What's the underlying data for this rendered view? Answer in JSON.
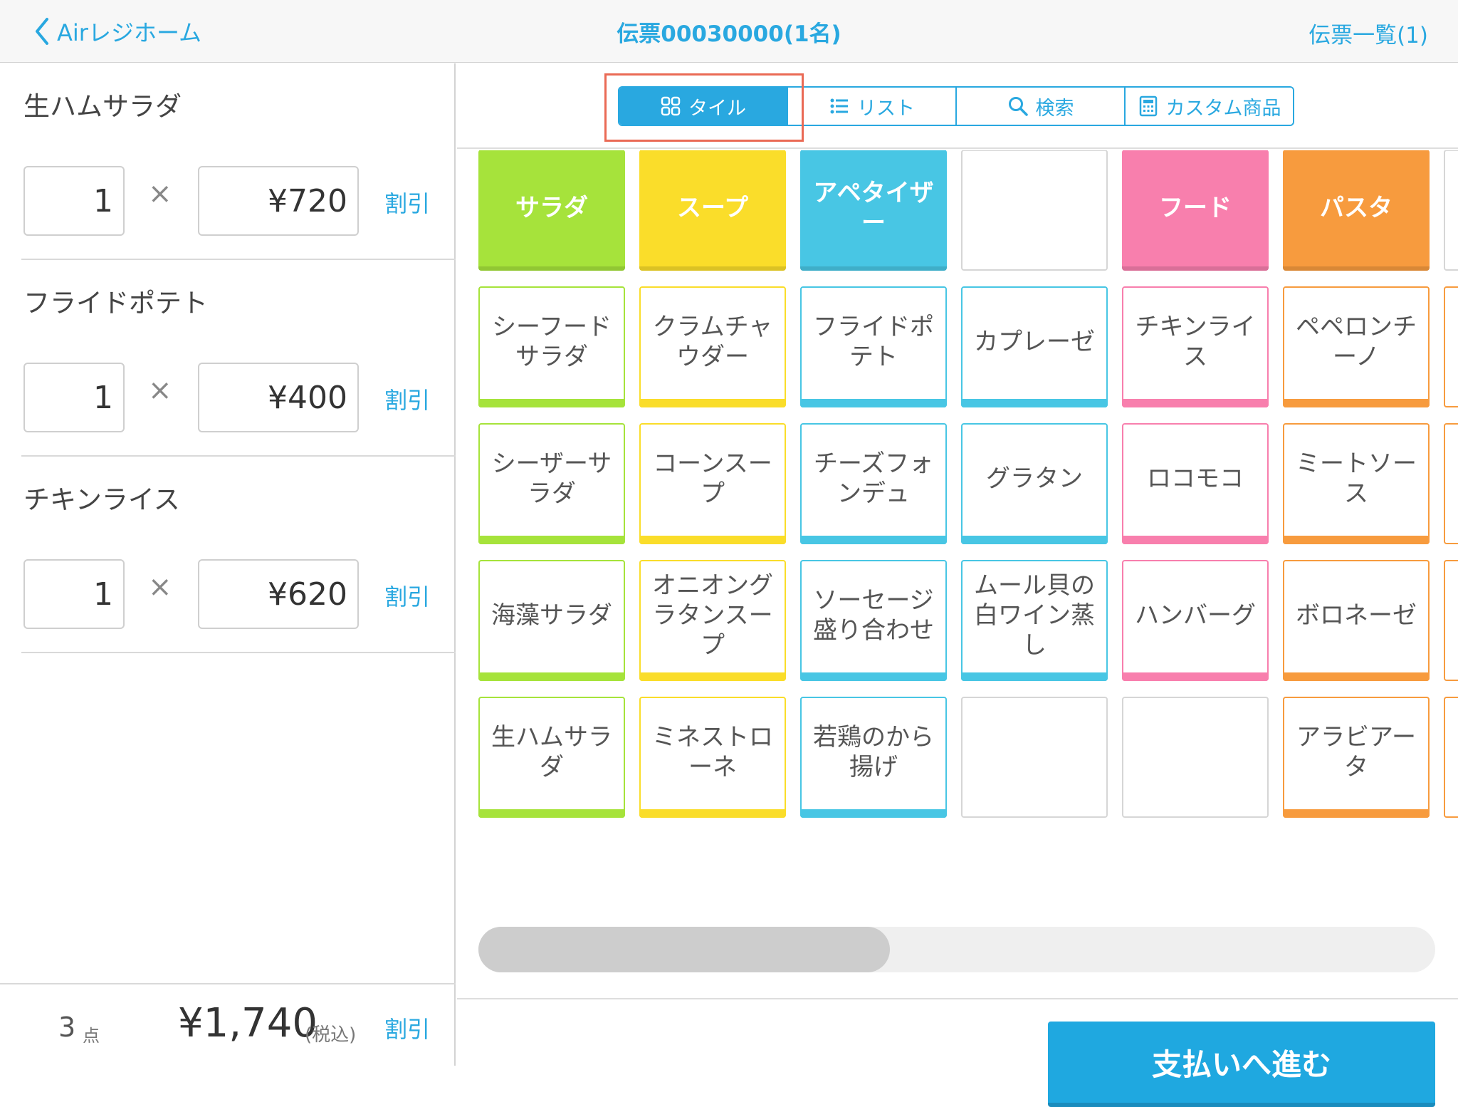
{
  "header": {
    "back_label": "Airレジホーム",
    "title": "伝票00030000(1名)",
    "ticket_list_label": "伝票一覧(1)"
  },
  "order": {
    "items": [
      {
        "name": "生ハムサラダ",
        "qty": "1",
        "times": "×",
        "price": "¥720",
        "discount_label": "割引"
      },
      {
        "name": "フライドポテト",
        "qty": "1",
        "times": "×",
        "price": "¥400",
        "discount_label": "割引"
      },
      {
        "name": "チキンライス",
        "qty": "1",
        "times": "×",
        "price": "¥620",
        "discount_label": "割引"
      }
    ],
    "footer": {
      "count": "3",
      "count_unit": "点",
      "total": "¥1,740",
      "tax_label": "(税込)",
      "discount_label": "割引"
    }
  },
  "view_tabs": [
    {
      "label": "タイル",
      "icon": "tile-grid-icon",
      "active": true
    },
    {
      "label": "リスト",
      "icon": "list-icon",
      "active": false
    },
    {
      "label": "検索",
      "icon": "search-icon",
      "active": false
    },
    {
      "label": "カスタム商品",
      "icon": "calculator-icon",
      "active": false
    }
  ],
  "colors": {
    "accent": "#29a8e0",
    "salad": "#a6e33b",
    "soup": "#fadd2a",
    "appetizer": "#48c6e4",
    "food": "#f87fad",
    "pasta": "#f79b3e",
    "highlight": "#ea6a55"
  },
  "categories": [
    {
      "label": "サラダ",
      "color": "#a6e33b"
    },
    {
      "label": "スープ",
      "color": "#fadd2a"
    },
    {
      "label": "アペタイザー",
      "color": "#48c6e4"
    },
    {
      "label": "",
      "color": ""
    },
    {
      "label": "フード",
      "color": "#f87fad"
    },
    {
      "label": "パスタ",
      "color": "#f79b3e"
    }
  ],
  "products": [
    [
      {
        "label": "シーフードサラダ",
        "color": "#a6e33b"
      },
      {
        "label": "クラムチャウダー",
        "color": "#fadd2a"
      },
      {
        "label": "フライドポテト",
        "color": "#48c6e4"
      },
      {
        "label": "カプレーゼ",
        "color": "#48c6e4"
      },
      {
        "label": "チキンライス",
        "color": "#f87fad"
      },
      {
        "label": "ペペロンチーノ",
        "color": "#f79b3e"
      }
    ],
    [
      {
        "label": "シーザーサラダ",
        "color": "#a6e33b"
      },
      {
        "label": "コーンスープ",
        "color": "#fadd2a"
      },
      {
        "label": "チーズフォンデュ",
        "color": "#48c6e4"
      },
      {
        "label": "グラタン",
        "color": "#48c6e4"
      },
      {
        "label": "ロコモコ",
        "color": "#f87fad"
      },
      {
        "label": "ミートソース",
        "color": "#f79b3e"
      }
    ],
    [
      {
        "label": "海藻サラダ",
        "color": "#a6e33b"
      },
      {
        "label": "オニオングラタンスープ",
        "color": "#fadd2a"
      },
      {
        "label": "ソーセージ盛り合わせ",
        "color": "#48c6e4"
      },
      {
        "label": "ムール貝の白ワイン蒸し",
        "color": "#48c6e4"
      },
      {
        "label": "ハンバーグ",
        "color": "#f87fad"
      },
      {
        "label": "ボロネーゼ",
        "color": "#f79b3e"
      }
    ],
    [
      {
        "label": "生ハムサラダ",
        "color": "#a6e33b"
      },
      {
        "label": "ミネストローネ",
        "color": "#fadd2a"
      },
      {
        "label": "若鶏のから揚げ",
        "color": "#48c6e4"
      },
      {
        "label": "",
        "color": ""
      },
      {
        "label": "",
        "color": ""
      },
      {
        "label": "アラビアータ",
        "color": "#f79b3e"
      }
    ]
  ],
  "scroll": {
    "position_fraction": 0.43
  },
  "pay_button_label": "支払いへ進む"
}
